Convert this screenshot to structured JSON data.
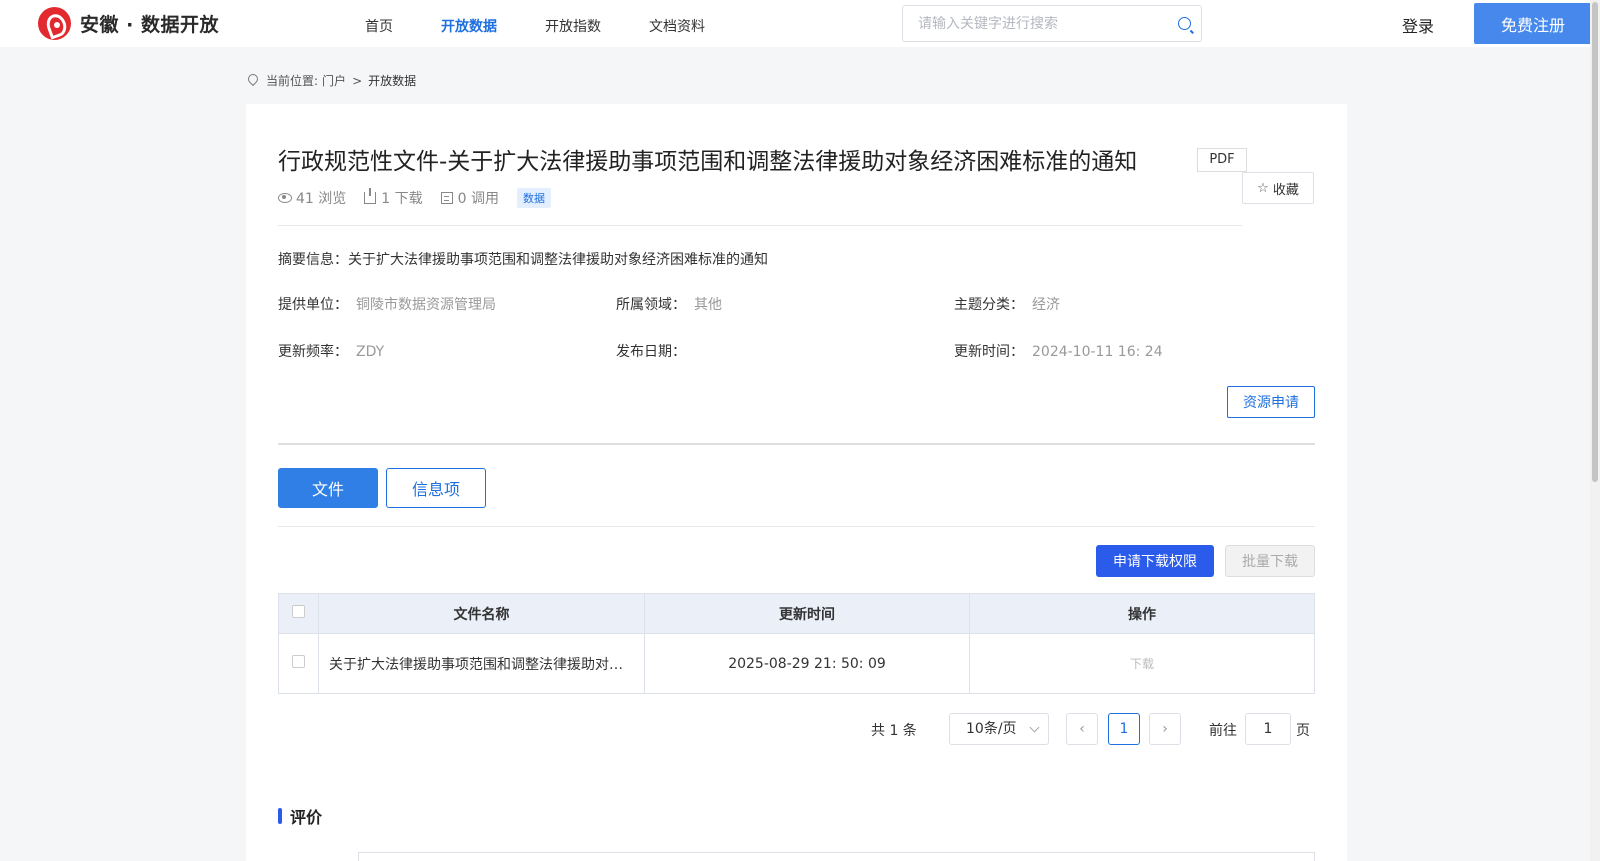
{
  "header": {
    "logo_text": "安徽 · 数据开放",
    "nav": [
      "首页",
      "开放数据",
      "开放指数",
      "文档资料"
    ],
    "search_placeholder": "请输入关键字进行搜索",
    "login": "登录",
    "register": "免费注册"
  },
  "breadcrumb": {
    "prefix": "当前位置:",
    "home": "门户",
    "sep": ">",
    "current": "开放数据"
  },
  "detail": {
    "title": "行政规范性文件-关于扩大法律援助事项范围和调整法律援助对象经济困难标准的通知",
    "format_tag": "PDF",
    "favorite": "收藏",
    "views": "41 浏览",
    "downloads": "1 下载",
    "calls": "0 调用",
    "type_tag": "数据",
    "summary": "摘要信息：关于扩大法律援助事项范围和调整法律援助对象经济困难标准的通知",
    "meta": {
      "provider_label": "提供单位：",
      "provider": "铜陵市数据资源管理局",
      "domain_label": "所属领域：",
      "domain": "其他",
      "topic_label": "主题分类：",
      "topic": "经济",
      "frequency_label": "更新频率：",
      "frequency": "ZDY",
      "publish_label": "发布日期：",
      "publish": "",
      "updated_label": "更新时间：",
      "updated": "2024-10-11 16: 24"
    },
    "apply": "资源申请"
  },
  "tabs": [
    "文件",
    "信息项"
  ],
  "actions": {
    "request_download": "申请下载权限",
    "batch_download": "批量下载"
  },
  "table": {
    "headers": [
      "文件名称",
      "更新时间",
      "操作"
    ],
    "rows": [
      {
        "name": "关于扩大法律援助事项范围和调整法律援助对象经济困难标准的通知.pdf",
        "updated": "2025-08-29 21: 50: 09",
        "action": "下载"
      }
    ]
  },
  "pagination": {
    "total": "共 1 条",
    "page_size": "10条/页",
    "prev": "‹",
    "current_page": "1",
    "next": "›",
    "goto_label": "前往",
    "goto_value": "1",
    "page_suffix": "页"
  },
  "review": {
    "title": "评价"
  },
  "colors": {
    "primary": "#1e6fe0",
    "register": "#4688ec",
    "request": "#2a5bea",
    "logo": "#e2292e"
  }
}
